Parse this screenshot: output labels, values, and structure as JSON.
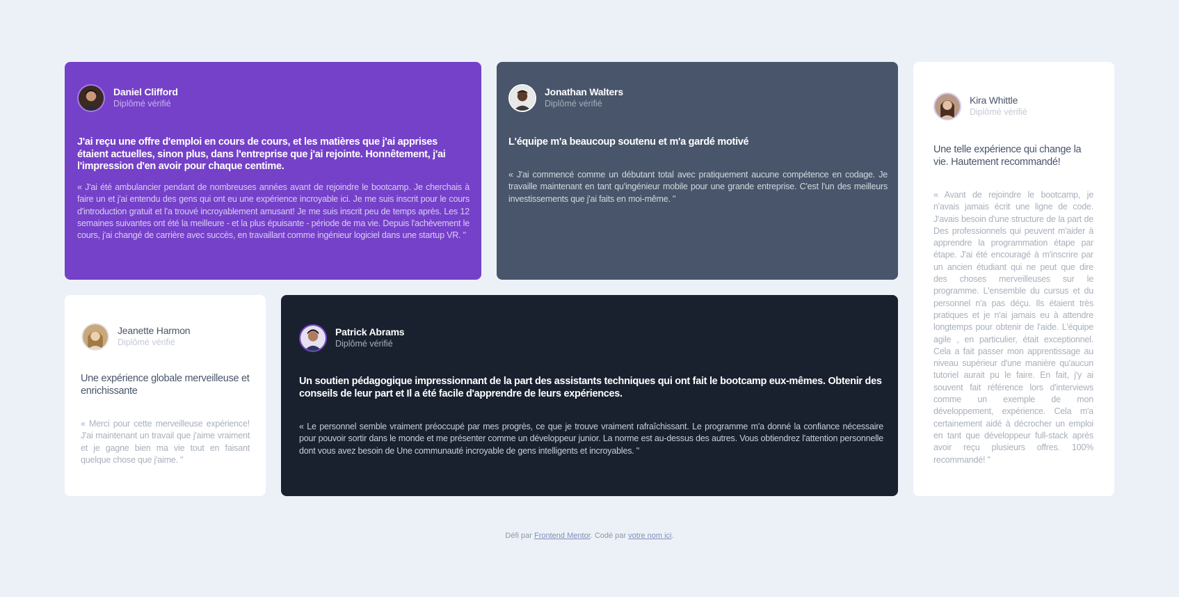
{
  "testimonials": [
    {
      "name": "Daniel Clifford",
      "status": "Diplômé vérifié",
      "headline": "J'ai reçu une offre d'emploi en cours de cours, et les matières que j'ai apprises étaient actuelles, sinon plus, dans l'entreprise que j'ai rejointe. Honnêtement, j'ai l'impression d'en avoir pour chaque centime.",
      "quote": "« J'ai été ambulancier pendant de nombreuses années avant de rejoindre le bootcamp. Je cherchais à faire un et j'ai entendu des gens qui ont eu une expérience incroyable ici. Je me suis inscrit pour le cours d'introduction gratuit et l'a trouvé incroyablement amusant! Je me suis inscrit peu de temps après. Les 12 semaines suivantes ont été la meilleure - et la plus épuisante - période de ma vie. Depuis l'achèvement le cours, j'ai changé de carrière avec succès, en travaillant comme ingénieur logiciel dans une startup VR. \""
    },
    {
      "name": "Jonathan Walters",
      "status": "Diplômé vérifié",
      "headline": "L'équipe m'a beaucoup soutenu et m'a gardé motivé",
      "quote": "« J'ai commencé comme un débutant total avec pratiquement aucune compétence en codage. Je travaille maintenant en tant qu'ingénieur mobile pour une grande entreprise. C'est l'un des meilleurs investissements que j'ai faits en moi-même. \""
    },
    {
      "name": "Kira Whittle",
      "status": "Diplômé vérifié",
      "headline": "Une telle expérience qui change la vie. Hautement recommandé!",
      "quote": "« Avant de rejoindre le bootcamp, je n'avais jamais écrit une ligne de code. J'avais besoin d'une structure de la part de Des professionnels qui peuvent m'aider à apprendre la programmation étape par étape. J'ai été encouragé à m'inscrire par un ancien étudiant qui ne peut que dire des choses merveilleuses sur le programme. L'ensemble du cursus et du personnel n'a pas déçu. Ils étaient très pratiques et je n'ai jamais eu à attendre longtemps pour obtenir de l'aide. L'équipe agile , en particulier, était exceptionnel. Cela a fait passer mon apprentissage au niveau supérieur d'une manière qu'aucun tutoriel aurait pu le faire. En fait, j'y ai souvent fait référence lors d'interviews comme un exemple de mon développement, expérience. Cela m'a certainement aidé à décrocher un emploi en tant que développeur full-stack après avoir reçu plusieurs offres. 100% recommandé! \""
    },
    {
      "name": "Jeanette Harmon",
      "status": "Diplômé vérifié",
      "headline": "Une expérience globale merveilleuse et enrichissante",
      "quote": "« Merci pour cette merveilleuse expérience! J'ai maintenant un travail que j'aime vraiment et je gagne bien ma vie tout en faisant quelque chose que j'aime. \""
    },
    {
      "name": "Patrick Abrams",
      "status": "Diplômé vérifié",
      "headline": "Un soutien pédagogique impressionnant de la part des assistants techniques qui ont fait le bootcamp eux-mêmes. Obtenir des conseils de leur part et Il a été facile d'apprendre de leurs expériences.",
      "quote": "« Le personnel semble vraiment préoccupé par mes progrès, ce que je trouve vraiment rafraîchissant. Le programme m'a donné la confiance nécessaire pour pouvoir sortir dans le monde et me présenter comme un développeur junior. La norme est au-dessus des autres. Vous obtiendrez l'attention personnelle dont vous avez besoin de Une communauté incroyable de gens intelligents et incroyables. \""
    }
  ],
  "footer": {
    "prefix": "Défi par ",
    "link1": "Frontend Mentor",
    "middle": ". Codé par ",
    "link2": "votre nom ici",
    "suffix": "."
  },
  "colors": {
    "background": "#ecf1f8",
    "purple": "#7541c8",
    "slate": "#48556a",
    "dark": "#19212e",
    "white": "#ffffff"
  }
}
